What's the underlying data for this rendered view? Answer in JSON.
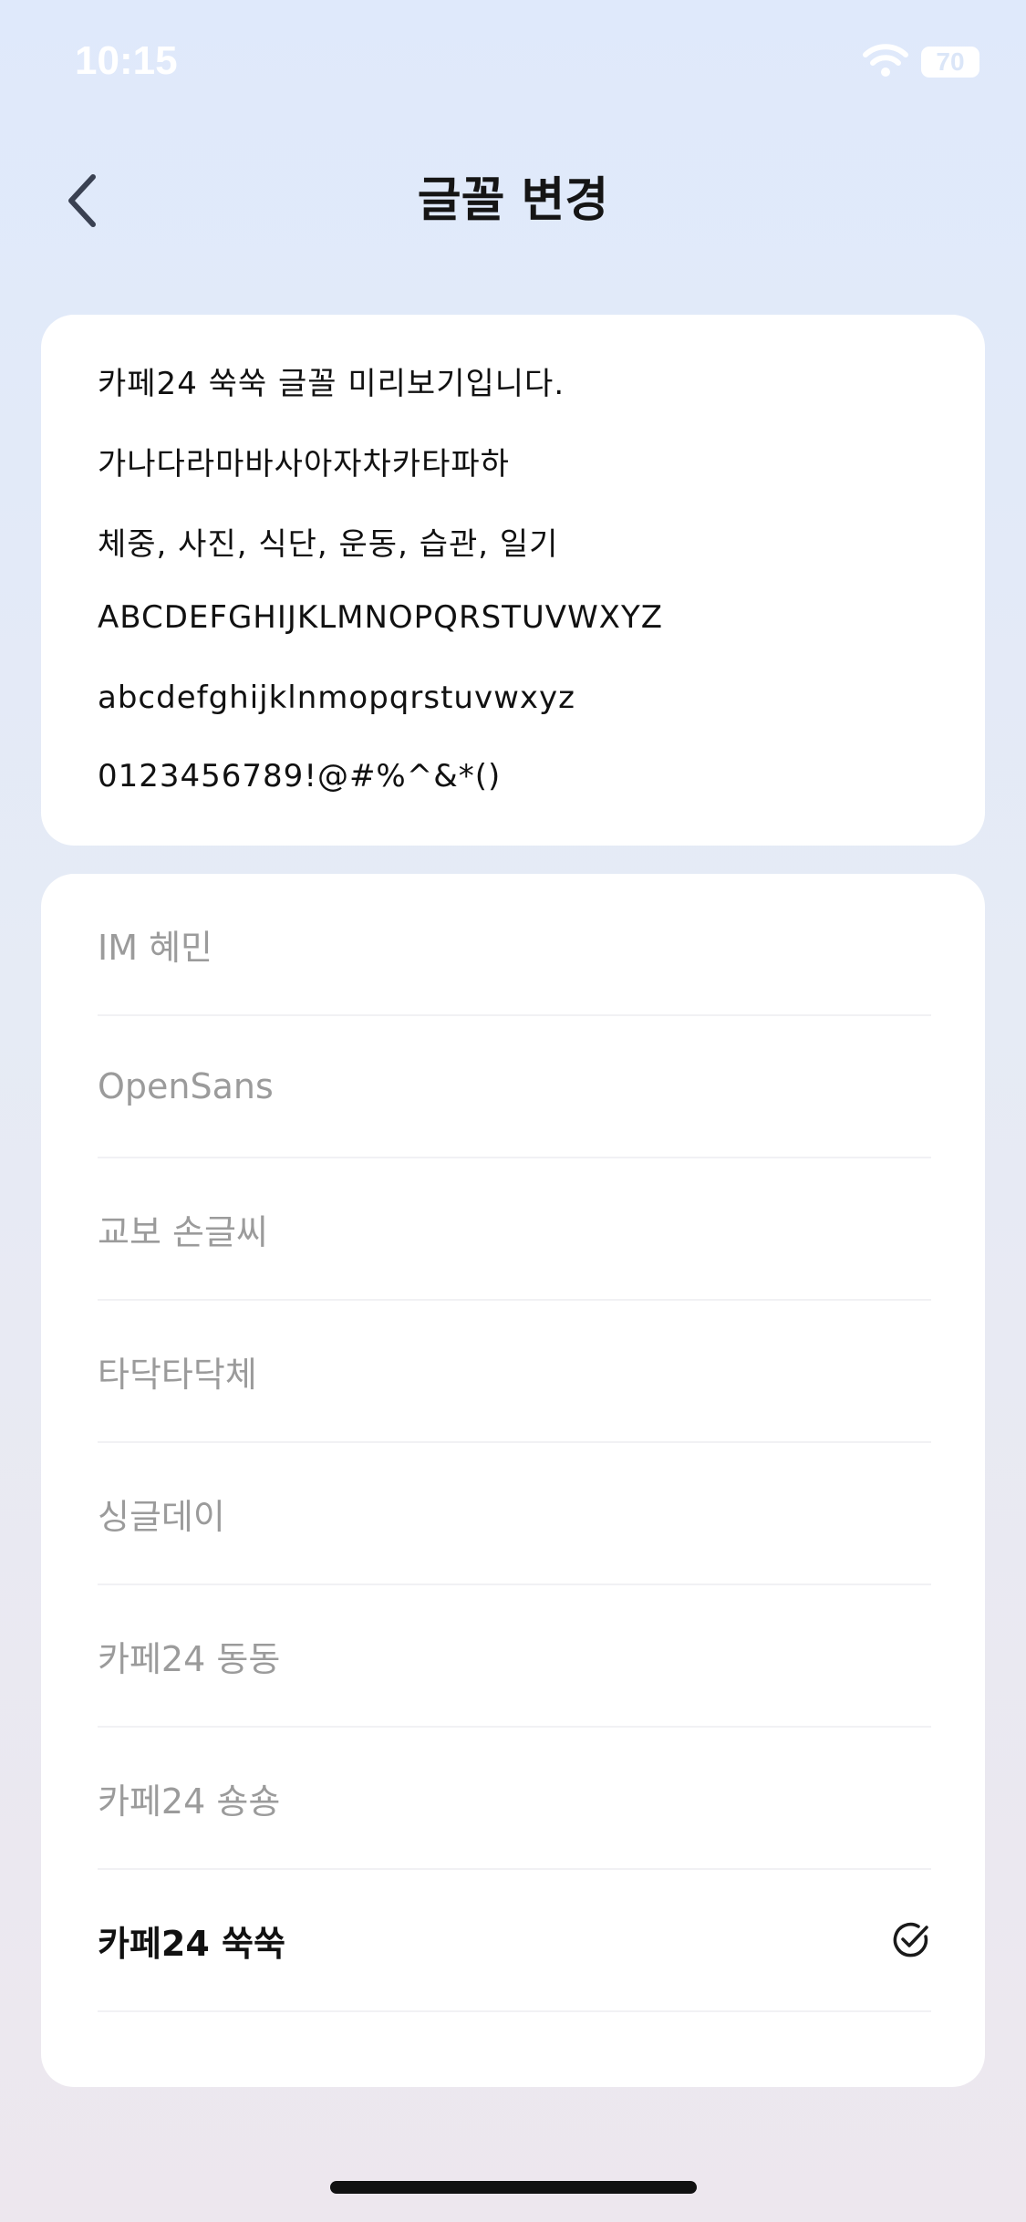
{
  "status_bar": {
    "time": "10:15",
    "battery": "70"
  },
  "header": {
    "title": "글꼴 변경"
  },
  "preview": {
    "lines": [
      "카페24 쑥쑥 글꼴 미리보기입니다.",
      "가나다라마바사아자차카타파하",
      "체중, 사진, 식단, 운동, 습관, 일기",
      "ABCDEFGHIJKLMNOPQRSTUVWXYZ",
      "abcdefghijklnmopqrstuvwxyz",
      "0123456789!@#%^&*()"
    ]
  },
  "font_list": {
    "items": [
      {
        "label": "IM 혜민",
        "selected": false
      },
      {
        "label": "OpenSans",
        "selected": false
      },
      {
        "label": "교보 손글씨",
        "selected": false
      },
      {
        "label": "타닥타닥체",
        "selected": false
      },
      {
        "label": "싱글데이",
        "selected": false
      },
      {
        "label": "카페24 동동",
        "selected": false
      },
      {
        "label": "카페24 숑숑",
        "selected": false
      },
      {
        "label": "카페24 쑥쑥",
        "selected": true
      }
    ]
  }
}
